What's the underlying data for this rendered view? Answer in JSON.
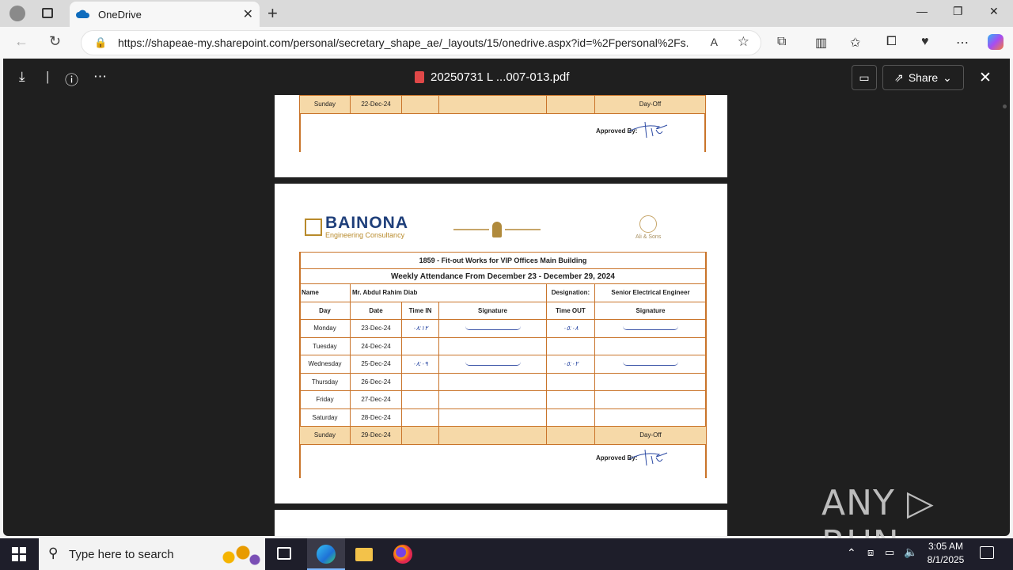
{
  "browser": {
    "tab_title": "OneDrive",
    "url": "https://shapeae-my.sharepoint.com/personal/secretary_shape_ae/_layouts/15/onedrive.aspx?id=%2Fpersonal%2Fs..."
  },
  "viewer": {
    "file_name": "20250731 L ...007-013.pdf",
    "share_label": "Share"
  },
  "prev_page": {
    "sunday_day": "Sunday",
    "sunday_date": "22-Dec-24",
    "sunday_note": "Day-Off",
    "approved_by": "Approved By:"
  },
  "page": {
    "logo_name": "BAINONA",
    "logo_sub": "Engineering Consultancy",
    "right_logo_text": "Ali & Sons",
    "project_title": "1859 - Fit-out Works for VIP Offices Main Building",
    "week_title": "Weekly Attendance From December 23 - December 29, 2024",
    "name_label": "Name",
    "name_value": "Mr. Abdul Rahim Diab",
    "designation_label": "Designation:",
    "designation_value": "Senior Electrical Engineer",
    "columns": [
      "Day",
      "Date",
      "Time IN",
      "Signature",
      "Time OUT",
      "Signature"
    ],
    "rows": [
      {
        "day": "Monday",
        "date": "23-Dec-24",
        "time_in": "٠٨:١٢",
        "time_out": "٠٥:٠٨",
        "signed": true
      },
      {
        "day": "Tuesday",
        "date": "24-Dec-24",
        "time_in": "",
        "time_out": "",
        "signed": false
      },
      {
        "day": "Wednesday",
        "date": "25-Dec-24",
        "time_in": "٠٨:٠٩",
        "time_out": "٠٥:٠٢",
        "signed": true
      },
      {
        "day": "Thursday",
        "date": "26-Dec-24",
        "time_in": "",
        "time_out": "",
        "signed": false
      },
      {
        "day": "Friday",
        "date": "27-Dec-24",
        "time_in": "",
        "time_out": "",
        "signed": false
      },
      {
        "day": "Saturday",
        "date": "28-Dec-24",
        "time_in": "",
        "time_out": "",
        "signed": false
      },
      {
        "day": "Sunday",
        "date": "29-Dec-24",
        "time_in": "",
        "time_out": "",
        "signed": false,
        "note": "Day-Off"
      }
    ],
    "approved_by": "Approved By:"
  },
  "taskbar": {
    "search_placeholder": "Type here to search",
    "time": "3:05 AM",
    "date": "8/1/2025"
  },
  "watermark": "ANY ▷ RUN"
}
